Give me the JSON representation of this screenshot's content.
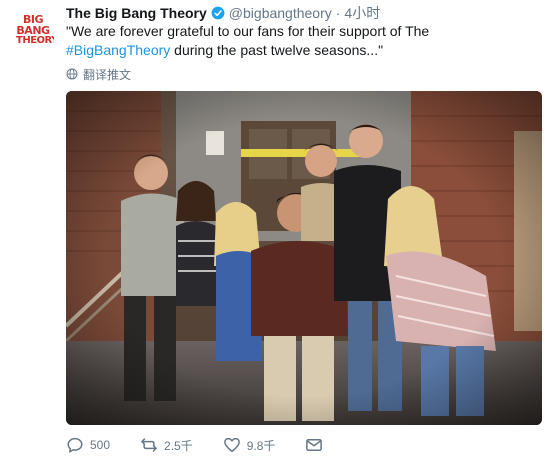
{
  "account": {
    "name": "The Big Bang Theory",
    "handle": "@bigbangtheory",
    "separator": "·",
    "time": "4小时",
    "avatar_logo": [
      "BIG",
      "BANG",
      "THEORY"
    ]
  },
  "tweet": {
    "text_before": "\"We are forever grateful to our fans for their support of The ",
    "hashtag": "#BigBangTheory",
    "text_after": " during the past twelve seasons...\""
  },
  "translate": {
    "label": "翻译推文",
    "icon": "globe-icon"
  },
  "photo": {
    "icon": "photo"
  },
  "actions": {
    "reply": {
      "icon": "reply-icon",
      "count": "500"
    },
    "retweet": {
      "icon": "retweet-icon",
      "count": "2.5千"
    },
    "like": {
      "icon": "heart-icon",
      "count": "9.8千"
    },
    "message": {
      "icon": "envelope-icon"
    }
  },
  "colors": {
    "link": "#1b95e0",
    "muted": "#657786",
    "verified": "#1da1f2",
    "logo_red": "#d0312d"
  }
}
